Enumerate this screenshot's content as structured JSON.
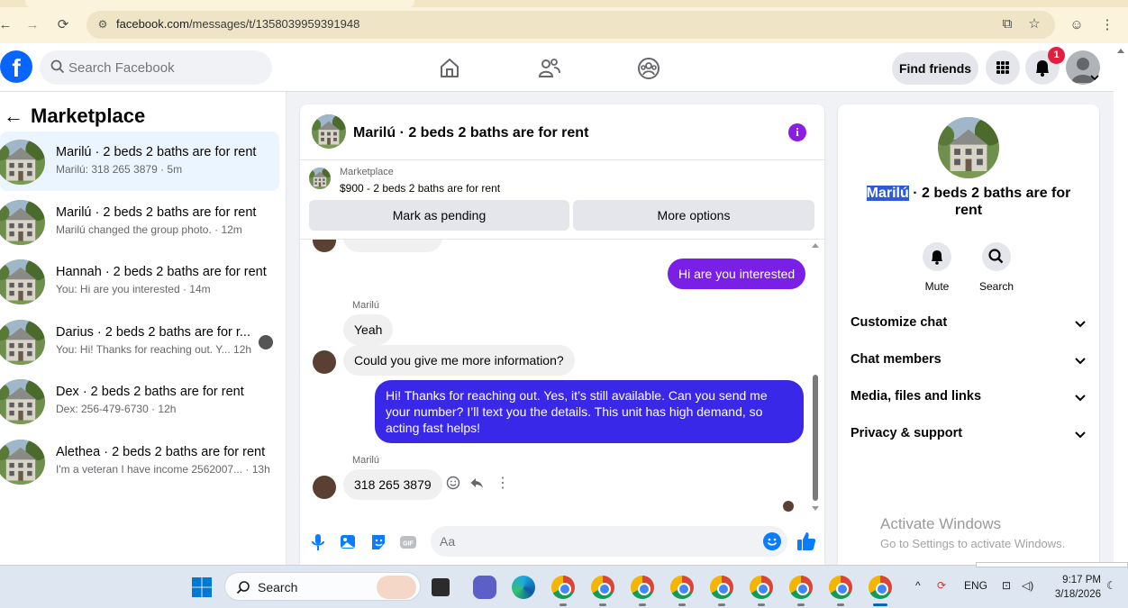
{
  "browser": {
    "url_host": "facebook.com",
    "url_path": "/messages/t/1358039959391948"
  },
  "topbar": {
    "logo": "f",
    "search_placeholder": "Search Facebook",
    "find_friends": "Find friends",
    "notification_count": "1"
  },
  "left": {
    "title": "Marketplace",
    "conversations": [
      {
        "name": "Marilú · 2 beds 2 baths are for rent",
        "sub": "Marilú: 318 265 3879 · 5m",
        "active": true
      },
      {
        "name": "Marilú · 2 beds 2 baths are for rent",
        "sub": "Marilú changed the group photo. · 12m"
      },
      {
        "name": "Hannah · 2 beds 2 baths are for rent",
        "sub": "You: Hi are you interested · 14m"
      },
      {
        "name": "Darius · 2 beds 2 baths are for r...",
        "sub": "You: Hi! Thanks for reaching out. Y... 12h"
      },
      {
        "name": "Dex · 2 beds 2 baths are for rent",
        "sub": "Dex: 256-479-6730 · 12h"
      },
      {
        "name": "Alethea · 2 beds 2 baths are for rent",
        "sub": "I'm a veteran I have income 2562007... · 13h"
      }
    ]
  },
  "chat": {
    "title": "Marilú · 2 beds 2 baths are for rent",
    "info": "i",
    "listing_category": "Marketplace",
    "listing_price": "$900 - 2 beds 2 baths are for rent",
    "mark_pending": "Mark as pending",
    "more_options": "More options",
    "messages": {
      "out1": "Hi are you interested",
      "sender1": "Marilú",
      "in1": "Yeah",
      "in2": "Could you give me more information?",
      "out2": "Hi! Thanks for reaching out. Yes, it’s still available. Can you send me your number? I’ll text you the details. This unit has high demand, so acting fast helps!",
      "sender2": "Marilú",
      "in3": "318 265 3879"
    },
    "composer_placeholder": "Aa"
  },
  "right": {
    "title_highlight": "Marilú",
    "title_rest": " · 2 beds 2 baths are for rent",
    "mute": "Mute",
    "search": "Search",
    "rows": [
      "Customize chat",
      "Chat members",
      "Media, files and links",
      "Privacy & support"
    ],
    "activate_title": "Activate Windows",
    "activate_sub": "Go to Settings to activate Windows."
  },
  "taskbar": {
    "search": "Search",
    "lang": "ENG",
    "time": "9:17 PM",
    "date": "3/18/2026"
  },
  "colors": {
    "fb_blue": "#0866ff",
    "out_bubble_purple": "#7a1fe6",
    "out_bubble_blue": "#3a28e8",
    "active_conv": "#ebf5ff",
    "notif_red": "#e41e3f"
  }
}
